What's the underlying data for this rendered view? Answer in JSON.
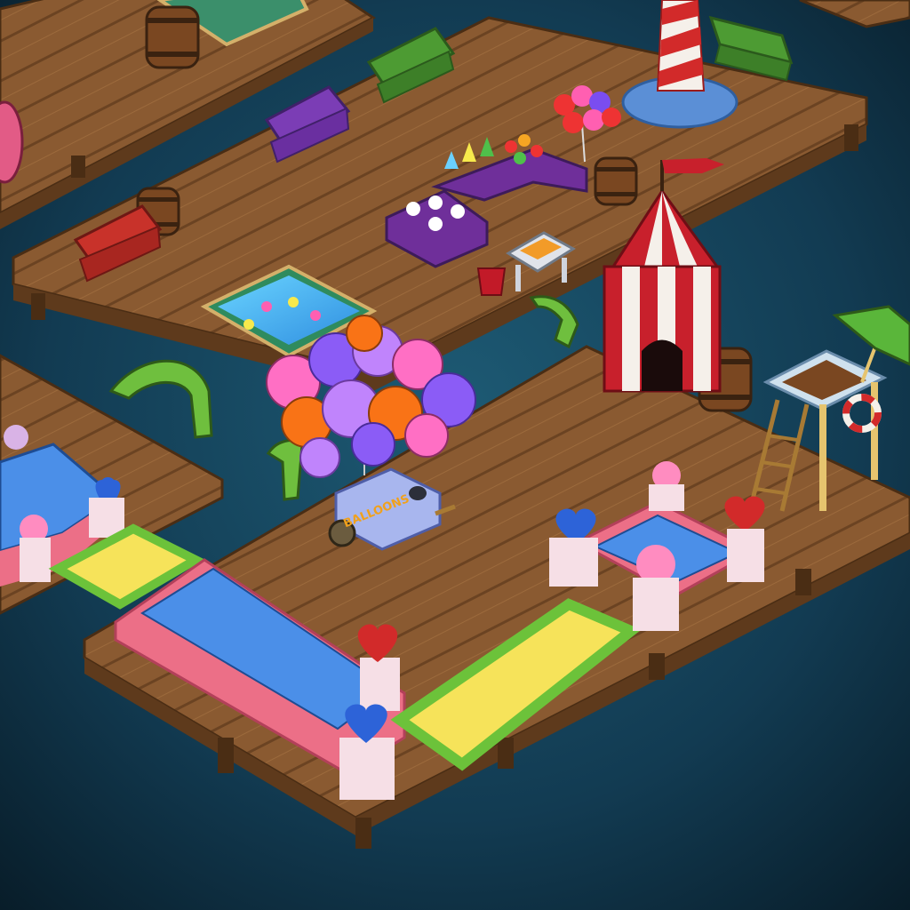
{
  "scene": {
    "cart_label": "BALLOONS"
  },
  "colors": {
    "water": "#123b52",
    "water_deep": "#0b2636",
    "dock": "#8a5a31",
    "dock_dark": "#5e3a1c",
    "tent_red": "#c8202c",
    "tent_white": "#f5f0ea",
    "bounce_blue": "#4b8fe8",
    "bounce_pink": "#ec6f87",
    "bounce_yellow": "#f6e35a",
    "bounce_green": "#6cc23a",
    "bench_green": "#4d9b33",
    "bench_purple": "#7b3db5",
    "bench_red": "#c8322a"
  }
}
